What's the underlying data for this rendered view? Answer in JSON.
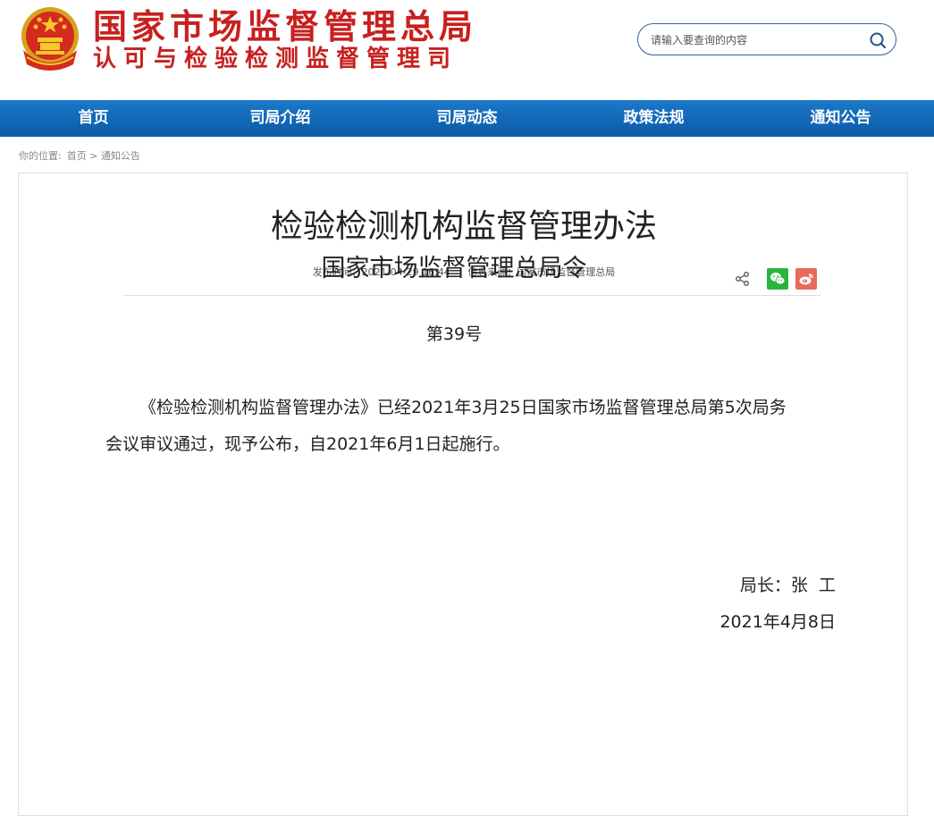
{
  "header": {
    "title_main": "国家市场监督管理总局",
    "title_sub": "认可与检验检测监督管理司",
    "emblem_icon": "national-emblem-icon",
    "brand_color": "#c8201f"
  },
  "search": {
    "placeholder": "请输入要查询的内容",
    "icon": "search-icon"
  },
  "nav": {
    "items": [
      {
        "label": "首页"
      },
      {
        "label": "司局介绍"
      },
      {
        "label": "司局动态"
      },
      {
        "label": "政策法规"
      },
      {
        "label": "通知公告"
      }
    ],
    "color": "#0b5aa8"
  },
  "breadcrumb": {
    "prefix": "你的位置:",
    "home": "首页 >",
    "current": "通知公告"
  },
  "article": {
    "title": "检验检测机构监督管理办法",
    "publish_time": "发布时间：2021-04-29 16:44",
    "source": "信息来源：国家市场监督管理总局",
    "share_icons": [
      "share-icon",
      "wechat-icon",
      "weibo-icon"
    ],
    "order_title": "国家市场监督管理总局令",
    "order_no": "第39号",
    "paragraph": "《检验检测机构监督管理办法》已经2021年3月25日国家市场监督管理总局第5次局务会议审议通过，现予公布，自2021年6月1日起施行。",
    "signature": "局长：张  工",
    "date": "2021年4月8日"
  }
}
